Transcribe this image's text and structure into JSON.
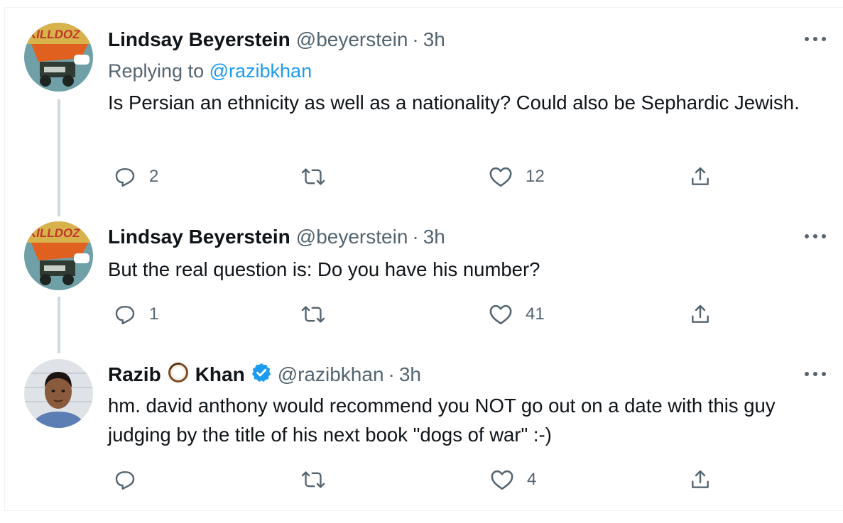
{
  "tweets": [
    {
      "name": "Lindsay Beyerstein",
      "handle": "@beyerstein",
      "separator": "·",
      "time": "3h",
      "replying_prefix": "Replying to",
      "replying_to": "@razibkhan",
      "text": "Is Persian an ethnicity as well as a nationality? Could also be Sephardic Jewish.",
      "replies": "2",
      "retweets": "",
      "likes": "12"
    },
    {
      "name": "Lindsay Beyerstein",
      "handle": "@beyerstein",
      "separator": "·",
      "time": "3h",
      "text": "But the real question is: Do you have his number?",
      "replies": "1",
      "retweets": "",
      "likes": "41"
    },
    {
      "name_first": "Razib",
      "name_last": "Khan",
      "name_emoji": "coconut-emoji",
      "verified": true,
      "handle": "@razibkhan",
      "separator": "·",
      "time": "3h",
      "text": "hm. david anthony would recommend you NOT go out on a date with this guy judging by the title of his next book \"dogs of war\" :-)",
      "replies": "",
      "retweets": "",
      "likes": "4"
    }
  ],
  "icons": [
    "reply-icon",
    "retweet-icon",
    "like-icon",
    "share-icon",
    "more-icon",
    "verified-icon"
  ],
  "colors": {
    "text": "#0f1419",
    "secondary": "#536471",
    "link": "#1d9bf0",
    "thread_line": "#cfd9de",
    "verified": "#1d9bf0"
  }
}
